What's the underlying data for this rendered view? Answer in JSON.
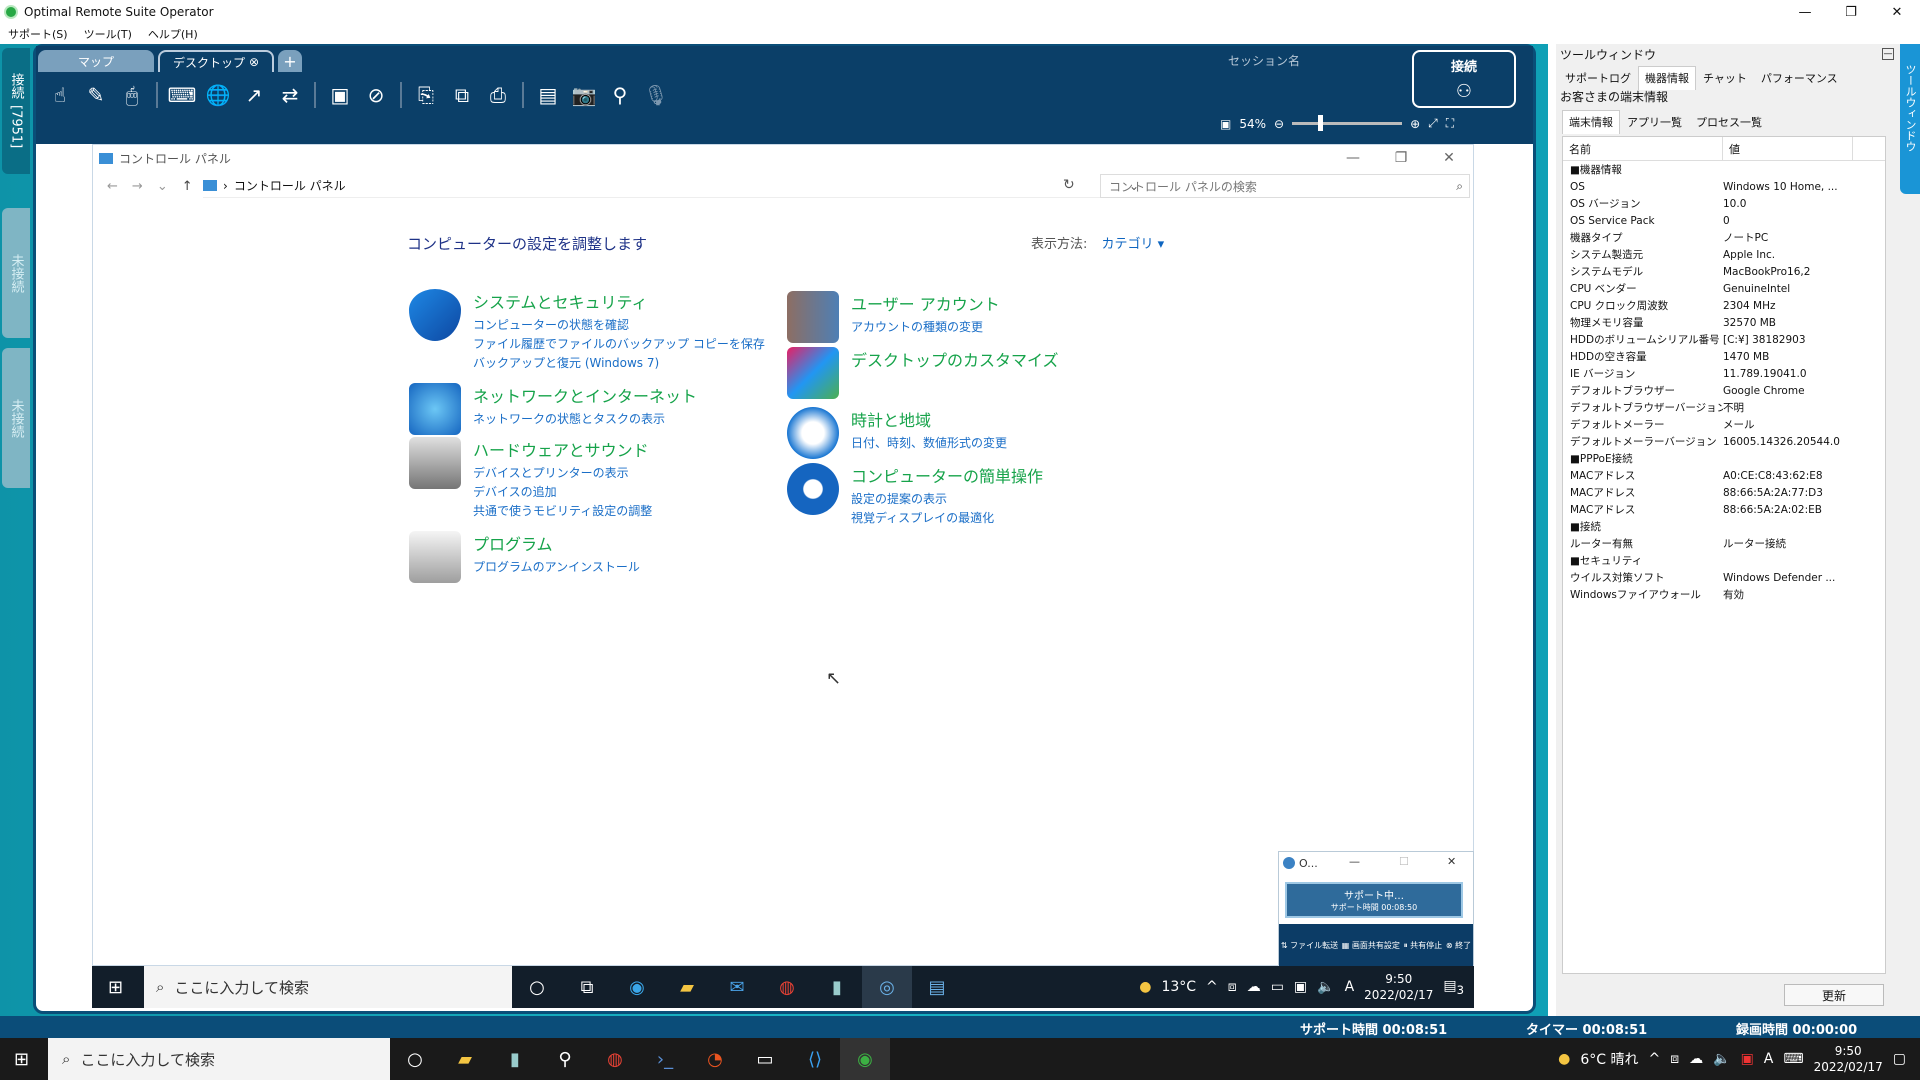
{
  "app": {
    "title": "Optimal Remote Suite Operator",
    "min": "—",
    "max": "❐",
    "close": "✕"
  },
  "menu": [
    "サポート(S)",
    "ツール(T)",
    "ヘルプ(H)"
  ],
  "side_tabs": {
    "connected": "接続",
    "session_id": "[7951]",
    "unconnected1": "未接続",
    "unconnected2": "未接続"
  },
  "viewer": {
    "tab_map": "マップ",
    "tab_desktop": "デスクトップ",
    "tab_add": "+",
    "session_label": "セッション名",
    "connect_label": "接続",
    "zoom": "54%"
  },
  "control_panel": {
    "window_title": "コントロール パネル",
    "breadcrumb": "コントロール パネル",
    "search_placeholder": "コントロール パネルの検索",
    "heading": "コンピューターの設定を調整します",
    "viewby_label": "表示方法:",
    "viewby_value": "カテゴリ ▾",
    "categories": [
      {
        "title": "システムとセキュリティ",
        "links": [
          "コンピューターの状態を確認",
          "ファイル履歴でファイルのバックアップ コピーを保存",
          "バックアップと復元 (Windows 7)"
        ]
      },
      {
        "title": "ネットワークとインターネット",
        "links": [
          "ネットワークの状態とタスクの表示"
        ]
      },
      {
        "title": "ハードウェアとサウンド",
        "links": [
          "デバイスとプリンターの表示",
          "デバイスの追加",
          "共通で使うモビリティ設定の調整"
        ]
      },
      {
        "title": "プログラム",
        "links": [
          "プログラムのアンインストール"
        ]
      },
      {
        "title": "ユーザー アカウント",
        "links": [
          "アカウントの種類の変更"
        ]
      },
      {
        "title": "デスクトップのカスタマイズ",
        "links": []
      },
      {
        "title": "時計と地域",
        "links": [
          "日付、時刻、数値形式の変更"
        ]
      },
      {
        "title": "コンピューターの簡単操作",
        "links": [
          "設定の提案の表示",
          "視覚ディスプレイの最適化"
        ]
      }
    ]
  },
  "mini_panel": {
    "title": "O...",
    "status": "サポート中…",
    "time": "サポート時間 00:08:50",
    "btn1": "ファイル転送",
    "btn2": "画面共有設定",
    "btn3": "共有停止",
    "btn4": "終了"
  },
  "remote_taskbar": {
    "search": "ここに入力して検索",
    "weather": "13°C",
    "time": "9:50",
    "date": "2022/02/17",
    "ime": "A",
    "notif": "3"
  },
  "status_bar": {
    "support_time": "サポート時間 00:08:51",
    "timer": "タイマー 00:08:51",
    "record_time": "録画時間 00:00:00"
  },
  "host_taskbar": {
    "search": "ここに入力して検索",
    "weather": "6°C 晴れ",
    "time": "9:50",
    "date": "2022/02/17",
    "ime": "A"
  },
  "tool_window": {
    "title": "ツールウィンドウ",
    "vertical_tab": "ツールウィンドウ",
    "tabs": [
      "サポートログ",
      "機器情報",
      "チャット",
      "パフォーマンス"
    ],
    "sub_title": "お客さまの端末情報",
    "sub_tabs": [
      "端末情報",
      "アプリ一覧",
      "プロセス一覧"
    ],
    "col_name": "名前",
    "col_value": "値",
    "rows": [
      [
        "■機器情報",
        ""
      ],
      [
        "OS",
        "Windows 10 Home, ..."
      ],
      [
        "OS バージョン",
        "10.0"
      ],
      [
        "OS Service Pack",
        "0"
      ],
      [
        "機器タイプ",
        "ノートPC"
      ],
      [
        "システム製造元",
        "Apple Inc."
      ],
      [
        "システムモデル",
        "MacBookPro16,2"
      ],
      [
        "CPU ベンダー",
        "GenuineIntel"
      ],
      [
        "CPU クロック周波数",
        "2304 MHz"
      ],
      [
        "物理メモリ容量",
        "32570 MB"
      ],
      [
        "HDDのボリュームシリアル番号",
        "[C:¥] 38182903"
      ],
      [
        "HDDの空き容量",
        "1470 MB"
      ],
      [
        "IE バージョン",
        "11.789.19041.0"
      ],
      [
        "デフォルトブラウザー",
        "Google Chrome"
      ],
      [
        "デフォルトブラウザーバージョン",
        "不明"
      ],
      [
        "デフォルトメーラー",
        "メール"
      ],
      [
        "デフォルトメーラーバージョン",
        "16005.14326.20544.0"
      ],
      [
        "■PPPoE接続",
        ""
      ],
      [
        "MACアドレス",
        "A0:CE:C8:43:62:E8"
      ],
      [
        "MACアドレス",
        "88:66:5A:2A:77:D3"
      ],
      [
        "MACアドレス",
        "88:66:5A:2A:02:EB"
      ],
      [
        "■接続",
        ""
      ],
      [
        "ルーター有無",
        "ルーター接続"
      ],
      [
        "■セキュリティ",
        ""
      ],
      [
        "ウイルス対策ソフト",
        "Windows Defender ..."
      ],
      [
        "Windowsファイアウォール",
        "有効"
      ]
    ],
    "refresh": "更新"
  }
}
